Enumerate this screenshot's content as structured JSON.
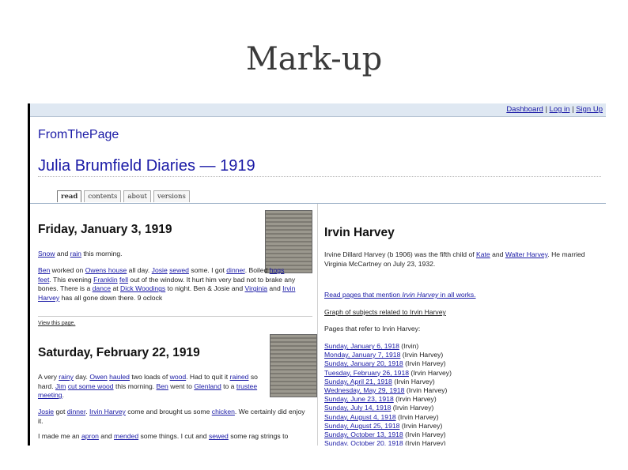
{
  "slide": {
    "title": "Mark-up"
  },
  "topbar": {
    "dashboard": "Dashboard",
    "login": "Log in",
    "signup": "Sign Up",
    "sep": "|"
  },
  "site": {
    "brand": "FromThePage",
    "collection": "Julia Brumfield Diaries",
    "dash": "—",
    "year": "1919"
  },
  "tabs": [
    "read",
    "contents",
    "about",
    "versions"
  ],
  "entries": [
    {
      "heading": "Friday, January 3, 1919",
      "p1": [
        [
          "link",
          "Snow"
        ],
        [
          "text",
          " and "
        ],
        [
          "link",
          "rain"
        ],
        [
          "text",
          " this morning."
        ]
      ],
      "p2": [
        [
          "link",
          "Ben"
        ],
        [
          "text",
          " worked on "
        ],
        [
          "link",
          "Owens house"
        ],
        [
          "text",
          " all day. "
        ],
        [
          "link",
          "Josie"
        ],
        [
          "text",
          " "
        ],
        [
          "link",
          "sewed"
        ],
        [
          "text",
          " some. I got "
        ],
        [
          "link",
          "dinner"
        ],
        [
          "text",
          ". Boiled "
        ],
        [
          "link",
          "hogs feet"
        ],
        [
          "text",
          ". This evening "
        ],
        [
          "link",
          "Franklin"
        ],
        [
          "text",
          " "
        ],
        [
          "link",
          "fell"
        ],
        [
          "text",
          " out of the window. It hurt him very bad not to brake any bones. There is a "
        ],
        [
          "link",
          "dance"
        ],
        [
          "text",
          " at "
        ],
        [
          "link",
          "Dick Woodings"
        ],
        [
          "text",
          " to night. Ben & Josie and "
        ],
        [
          "link",
          "Virginia"
        ],
        [
          "text",
          " and "
        ],
        [
          "link",
          "Irvin Harvey"
        ],
        [
          "text",
          " has all gone down there. 9 oclock"
        ]
      ],
      "view": "View this page."
    },
    {
      "heading": "Saturday, February 22, 1919",
      "p1": [
        [
          "text",
          "A very "
        ],
        [
          "link",
          "rainy"
        ],
        [
          "text",
          " day. "
        ],
        [
          "link",
          "Owen"
        ],
        [
          "text",
          " "
        ],
        [
          "link",
          "hauled"
        ],
        [
          "text",
          " two loads of "
        ],
        [
          "link",
          "wood"
        ],
        [
          "text",
          ". Had to quit it "
        ],
        [
          "link",
          "rained"
        ],
        [
          "text",
          " so hard. "
        ],
        [
          "link",
          "Jim"
        ],
        [
          "text",
          " "
        ],
        [
          "link",
          "cut some wood"
        ],
        [
          "text",
          " this morning. "
        ],
        [
          "link",
          "Ben"
        ],
        [
          "text",
          " went to "
        ],
        [
          "link",
          "Glenland"
        ],
        [
          "text",
          " to a "
        ],
        [
          "link",
          "trustee meeting"
        ],
        [
          "text",
          "."
        ]
      ],
      "p2": [
        [
          "link",
          "Josie"
        ],
        [
          "text",
          " got "
        ],
        [
          "link",
          "dinner"
        ],
        [
          "text",
          ". "
        ],
        [
          "link",
          "Irvin Harvey"
        ],
        [
          "text",
          " come and brought us some "
        ],
        [
          "link",
          "chicken"
        ],
        [
          "text",
          ". We certainly did enjoy it."
        ]
      ],
      "p3": [
        [
          "text",
          "I made me an "
        ],
        [
          "link",
          "apron"
        ],
        [
          "text",
          " and "
        ],
        [
          "link",
          "mended"
        ],
        [
          "text",
          " some things. I cut and "
        ],
        [
          "link",
          "sewed"
        ],
        [
          "text",
          " some rag strings to"
        ]
      ]
    }
  ],
  "subject": {
    "name": "Irvin Harvey",
    "bio": [
      [
        "text",
        "Irvine Dillard Harvey (b 1906) was the fifth child of "
      ],
      [
        "link",
        "Kate"
      ],
      [
        "text",
        " and "
      ],
      [
        "link",
        "Walter Harvey"
      ],
      [
        "text",
        ". He married Virginia McCartney on July 23, 1932."
      ]
    ],
    "read_mention_prefix": "Read pages that mention ",
    "read_mention_name": "Irvin Harvey",
    "read_mention_suffix": " in all works.",
    "graph_link": "Graph of subjects related to Irvin Harvey",
    "refer_label": "Pages that refer to Irvin Harvey:",
    "pages": [
      {
        "date": "Sunday, January 6, 1918",
        "note": " (Irvin)"
      },
      {
        "date": "Monday, January 7, 1918",
        "note": " (Irvin Harvey)"
      },
      {
        "date": "Sunday, January 20, 1918",
        "note": " (Irvin Harvey)"
      },
      {
        "date": "Tuesday, February 26, 1918",
        "note": " (Irvin Harvey)"
      },
      {
        "date": "Sunday, April 21, 1918",
        "note": " (Irvin Harvey)"
      },
      {
        "date": "Wednesday, May 29, 1918",
        "note": " (Irvin Harvey)"
      },
      {
        "date": "Sunday, June 23, 1918",
        "note": " (Irvin Harvey)"
      },
      {
        "date": "Sunday, July 14, 1918",
        "note": " (Irvin Harvey)"
      },
      {
        "date": "Sunday, August 4, 1918",
        "note": " (Irvin Harvey)"
      },
      {
        "date": "Sunday, August 25, 1918",
        "note": " (Irvin Harvey)"
      },
      {
        "date": "Sunday, October 13, 1918",
        "note": " (Irvin Harvey)"
      },
      {
        "date": "Sunday, October 20, 1918",
        "note": " (Irvin Harvey)"
      }
    ]
  }
}
